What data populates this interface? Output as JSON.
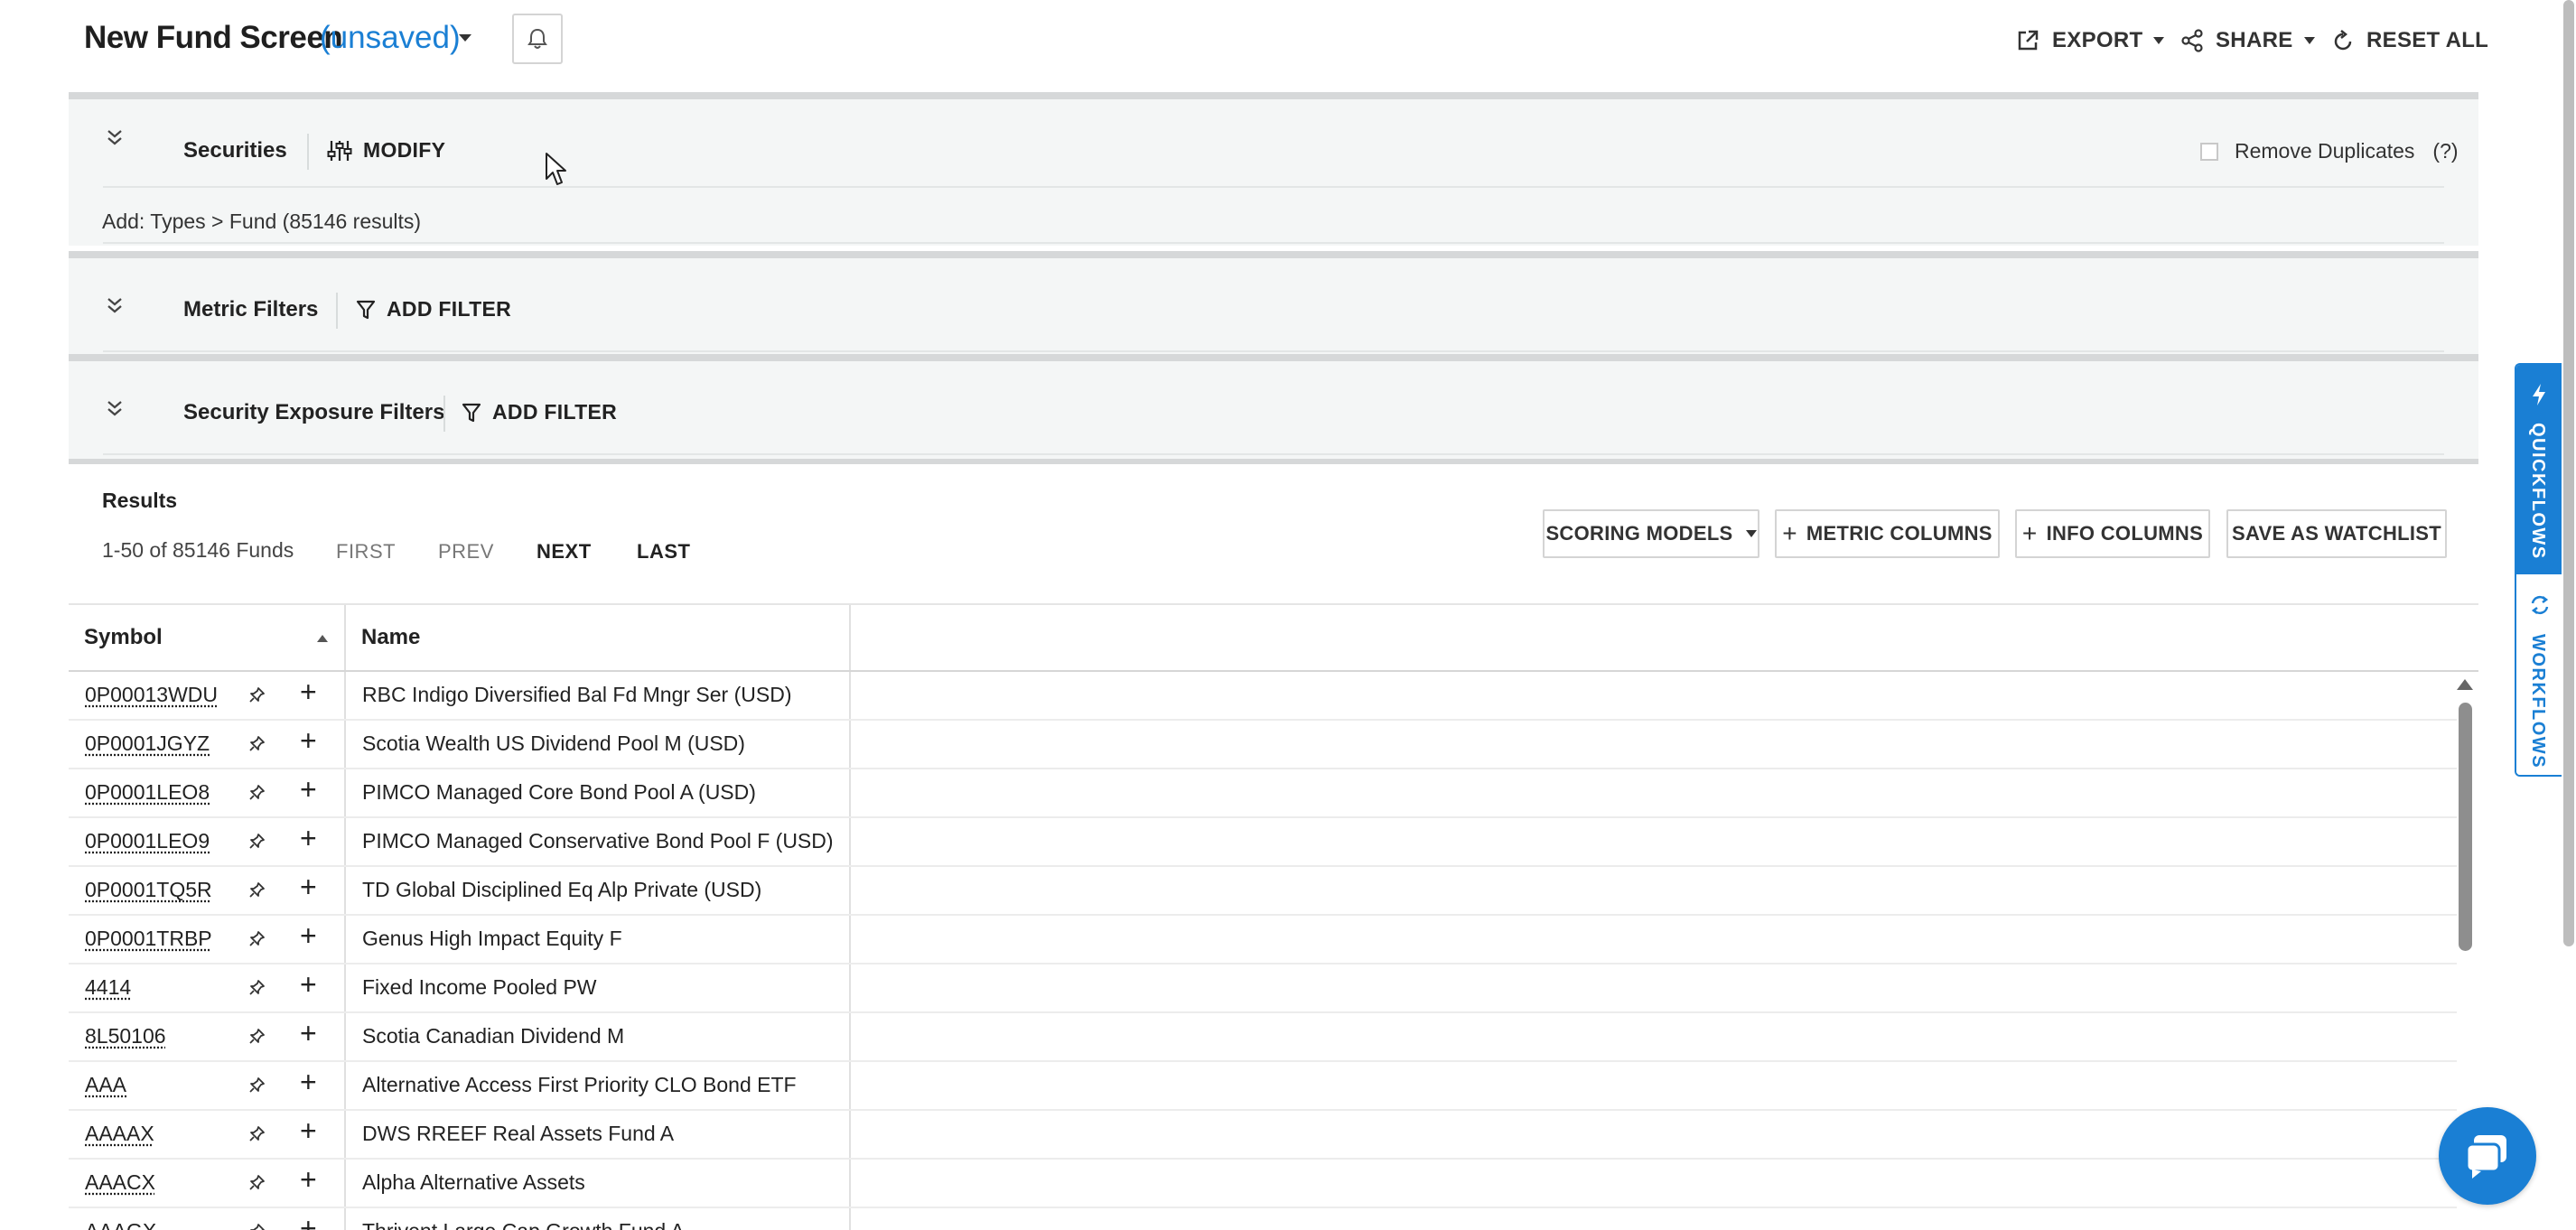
{
  "header": {
    "title": "New Fund Screen",
    "status": "(unsaved)",
    "export_label": "EXPORT",
    "share_label": "SHARE",
    "reset_label": "RESET ALL"
  },
  "securities_panel": {
    "label": "Securities",
    "modify_label": "MODIFY",
    "remove_duplicates_label": "Remove Duplicates",
    "help_label": "(?)",
    "remove_duplicates_checked": false,
    "summary": "Add: Types > Fund (85146 results)"
  },
  "metric_panel": {
    "label": "Metric Filters",
    "add_filter_label": "ADD FILTER"
  },
  "exposure_panel": {
    "label": "Security Exposure Filters",
    "add_filter_label": "ADD FILTER"
  },
  "results": {
    "title": "Results",
    "count": "1-50 of 85146 Funds",
    "pager": {
      "first": "FIRST",
      "prev": "PREV",
      "next": "NEXT",
      "last": "LAST"
    },
    "scoring_models_label": "SCORING MODELS",
    "metric_columns_label": "METRIC COLUMNS",
    "info_columns_label": "INFO COLUMNS",
    "save_watchlist_label": "SAVE AS WATCHLIST"
  },
  "table": {
    "columns": [
      "Symbol",
      "Name"
    ],
    "rows": [
      {
        "symbol": "0P00013WDU",
        "name": "RBC Indigo Diversified Bal Fd Mngr Ser (USD)"
      },
      {
        "symbol": "0P0001JGYZ",
        "name": "Scotia Wealth US Dividend Pool M (USD)"
      },
      {
        "symbol": "0P0001LEO8",
        "name": "PIMCO Managed Core Bond Pool A (USD)"
      },
      {
        "symbol": "0P0001LEO9",
        "name": "PIMCO Managed Conservative Bond Pool F (USD)"
      },
      {
        "symbol": "0P0001TQ5R",
        "name": "TD Global Disciplined Eq Alp Private (USD)"
      },
      {
        "symbol": "0P0001TRBP",
        "name": "Genus High Impact Equity F"
      },
      {
        "symbol": "4414",
        "name": "Fixed Income Pooled PW"
      },
      {
        "symbol": "8L50106",
        "name": "Scotia Canadian Dividend M"
      },
      {
        "symbol": "AAA",
        "name": "Alternative Access First Priority CLO Bond ETF"
      },
      {
        "symbol": "AAAAX",
        "name": "DWS RREEF Real Assets Fund A"
      },
      {
        "symbol": "AAACX",
        "name": "Alpha Alternative Assets"
      },
      {
        "symbol": "AAAGX",
        "name": "Thrivent Large Cap Growth Fund A"
      }
    ]
  },
  "side_tabs": {
    "quickflows": "QUICKFLOWS",
    "workflows": "WORKFLOWS"
  },
  "colors": {
    "accent": "#1a7fd4",
    "panel_bg": "#f4f6f6",
    "panel_border": "#d6d8d9"
  }
}
